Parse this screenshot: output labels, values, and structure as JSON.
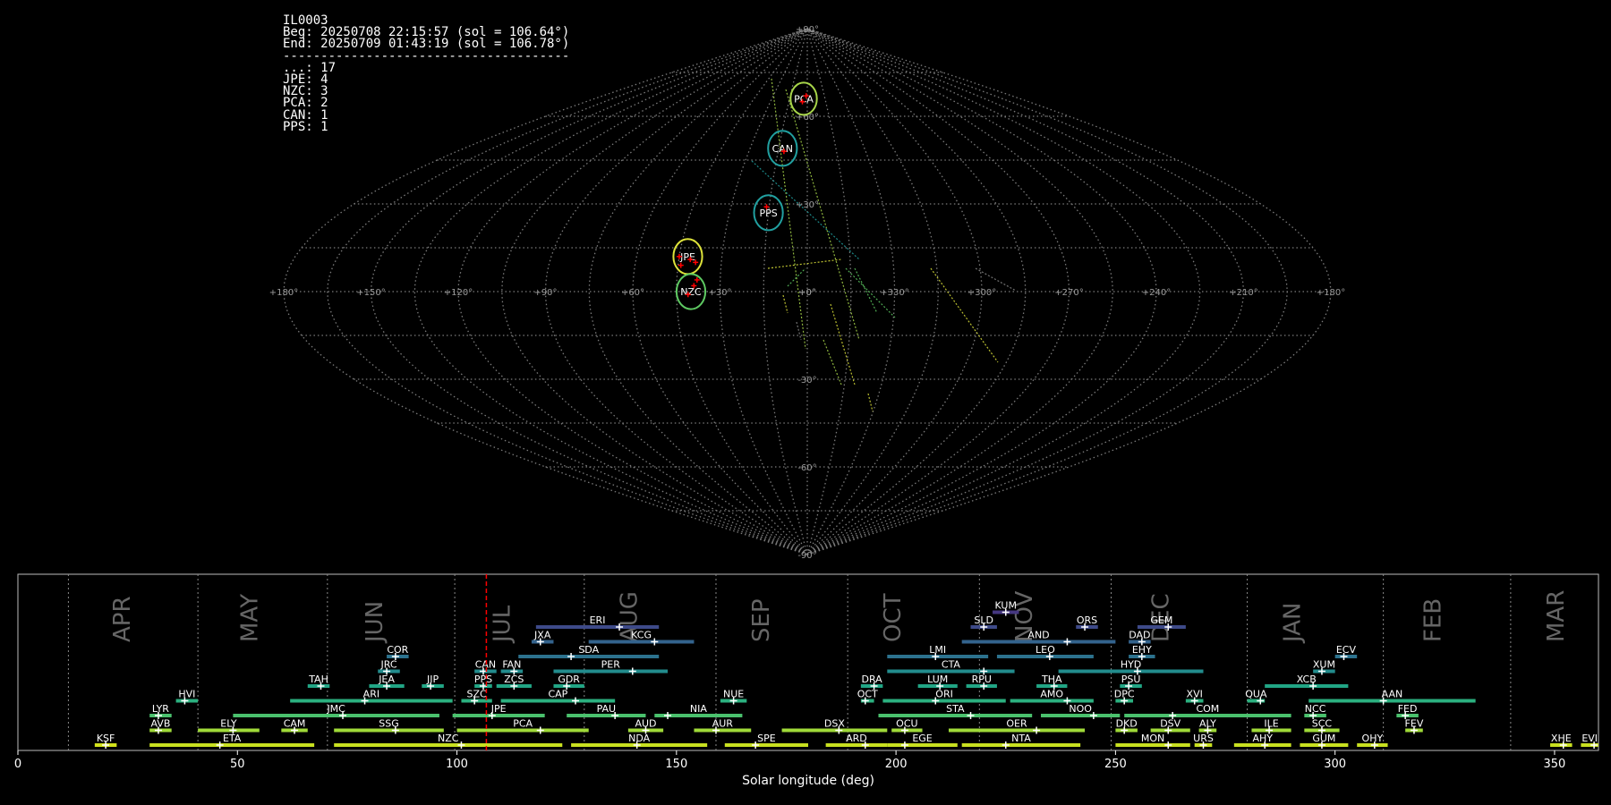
{
  "info": {
    "id": "IL0003",
    "beg": "Beg: 20250708 22:15:57 (sol = 106.64°)",
    "end": "End: 20250709 01:43:19 (sol = 106.78°)",
    "separator": "--------------------------------------",
    "counts": [
      "...: 17",
      "JPE: 4",
      "NZC: 3",
      "PCA: 2",
      "CAN: 1",
      "PPS: 1"
    ]
  },
  "colors": {
    "background": "#000000",
    "grid": "#9a9a9a",
    "highlight": "#ff0000",
    "yellow": "#dde23a",
    "green": "#5ec962",
    "teal": "#21a0a0",
    "blue": "#3b528b"
  },
  "chart_data": [
    {
      "type": "scatter",
      "projection": "sinusoidal",
      "lon_ticks": [
        "+180°",
        "+150°",
        "+120°",
        "+90°",
        "+60°",
        "+30°",
        "+0°",
        "+330°",
        "+300°",
        "+270°",
        "+240°",
        "+210°",
        "+180°"
      ],
      "lat_ticks": [
        "+90°",
        "+60°",
        "+30°",
        "+0°",
        "-30°",
        "-60°",
        "-90°"
      ],
      "grid": true,
      "shower_circles": [
        {
          "name": "PCA",
          "lon": -3,
          "lat": 66,
          "r": 5.5,
          "color": "#a8d64a"
        },
        {
          "name": "CAN",
          "lon": -13,
          "lat": 49,
          "r": 6,
          "color": "#21a0a0"
        },
        {
          "name": "PPS",
          "lon": -15,
          "lat": 27,
          "r": 6,
          "color": "#21a0a0"
        },
        {
          "name": "JPE",
          "lon": -42,
          "lat": 12,
          "r": 6,
          "color": "#dde23a"
        },
        {
          "name": "NZC",
          "lon": -40,
          "lat": 0,
          "r": 6,
          "color": "#5ec962"
        }
      ],
      "radiants": [
        {
          "lon": -1,
          "lat": 67
        },
        {
          "lon": -4,
          "lat": 65
        },
        {
          "lon": -12,
          "lat": 48
        },
        {
          "lon": -16,
          "lat": 29
        },
        {
          "lon": -41,
          "lat": 11
        },
        {
          "lon": -44,
          "lat": 9
        },
        {
          "lon": -39,
          "lat": 10
        },
        {
          "lon": -45,
          "lat": 12
        },
        {
          "lon": -38,
          "lat": 4
        },
        {
          "lon": -41,
          "lat": -1
        },
        {
          "lon": -39,
          "lat": 2
        }
      ]
    },
    {
      "type": "bar",
      "xlabel": "Solar longitude (deg)",
      "xlim": [
        0,
        360
      ],
      "x_ticks": [
        0,
        50,
        100,
        150,
        200,
        250,
        300,
        350
      ],
      "current_sol": 106.7,
      "months": [
        {
          "name": "APR",
          "x": 25.5,
          "line": 11.5
        },
        {
          "name": "MAY",
          "x": 54.5,
          "line": 41
        },
        {
          "name": "JUN",
          "x": 83,
          "line": 70.5
        },
        {
          "name": "JUL",
          "x": 112,
          "line": 99.5
        },
        {
          "name": "AUG",
          "x": 141,
          "line": 129
        },
        {
          "name": "SEP",
          "x": 171,
          "line": 159
        },
        {
          "name": "OCT",
          "x": 201,
          "line": 189
        },
        {
          "name": "NOV",
          "x": 231,
          "line": 219
        },
        {
          "name": "DEC",
          "x": 262,
          "line": 249
        },
        {
          "name": "JAN",
          "x": 292,
          "line": 280
        },
        {
          "name": "FEB",
          "x": 324,
          "line": 311
        },
        {
          "name": "MAR",
          "x": 352,
          "line": 340
        }
      ],
      "showers": [
        {
          "name": "KSF",
          "start": 17.5,
          "end": 22.5,
          "peak": 20,
          "row": 0,
          "color": "#d2e21b"
        },
        {
          "name": "ETA",
          "start": 30,
          "end": 67.5,
          "peak": 46,
          "row": 0,
          "color": "#c8e020"
        },
        {
          "name": "NZC",
          "start": 72,
          "end": 124,
          "peak": 101,
          "row": 0,
          "color": "#c8e020"
        },
        {
          "name": "NDA",
          "start": 126,
          "end": 157,
          "peak": 141,
          "row": 0,
          "color": "#c8e020"
        },
        {
          "name": "SPE",
          "start": 161,
          "end": 180,
          "peak": 168,
          "row": 0,
          "color": "#c8e020"
        },
        {
          "name": "ARD",
          "start": 184,
          "end": 198,
          "peak": 193,
          "row": 0,
          "color": "#c8e020"
        },
        {
          "name": "EGE",
          "start": 198,
          "end": 214,
          "peak": 202,
          "row": 0,
          "color": "#c8e020"
        },
        {
          "name": "NTA",
          "start": 215,
          "end": 242,
          "peak": 225,
          "row": 0,
          "color": "#c8e020"
        },
        {
          "name": "MON",
          "start": 250,
          "end": 267,
          "peak": 262,
          "row": 0,
          "color": "#c8e020"
        },
        {
          "name": "URS",
          "start": 268,
          "end": 272,
          "peak": 270,
          "row": 0,
          "color": "#c8e020"
        },
        {
          "name": "AHY",
          "start": 277,
          "end": 290,
          "peak": 284,
          "row": 0,
          "color": "#c8e020"
        },
        {
          "name": "GUM",
          "start": 292,
          "end": 303,
          "peak": 297,
          "row": 0,
          "color": "#c8e020"
        },
        {
          "name": "OHY",
          "start": 305,
          "end": 312,
          "peak": 309,
          "row": 0,
          "color": "#c8e020"
        },
        {
          "name": "XHE",
          "start": 349,
          "end": 354,
          "peak": 352,
          "row": 0,
          "color": "#c8e020"
        },
        {
          "name": "EVI",
          "start": 356,
          "end": 361,
          "peak": 359,
          "row": 0,
          "color": "#c8e020"
        },
        {
          "name": "AVB",
          "start": 30,
          "end": 35,
          "peak": 32,
          "row": 1,
          "color": "#a0da39"
        },
        {
          "name": "ELY",
          "start": 41,
          "end": 55,
          "peak": 49,
          "row": 1,
          "color": "#a0da39"
        },
        {
          "name": "CAM",
          "start": 60,
          "end": 66,
          "peak": 63,
          "row": 1,
          "color": "#a0da39"
        },
        {
          "name": "SSG",
          "start": 72,
          "end": 97,
          "peak": 86,
          "row": 1,
          "color": "#a0da39"
        },
        {
          "name": "PCA",
          "start": 100,
          "end": 130,
          "peak": 119,
          "row": 1,
          "color": "#a0da39"
        },
        {
          "name": "AUD",
          "start": 139,
          "end": 147,
          "peak": 143,
          "row": 1,
          "color": "#a0da39"
        },
        {
          "name": "AUR",
          "start": 154,
          "end": 167,
          "peak": 159,
          "row": 1,
          "color": "#a0da39"
        },
        {
          "name": "DSX",
          "start": 174,
          "end": 198,
          "peak": 187,
          "row": 1,
          "color": "#a0da39"
        },
        {
          "name": "OCU",
          "start": 199,
          "end": 206,
          "peak": 202,
          "row": 1,
          "color": "#a0da39"
        },
        {
          "name": "OER",
          "start": 212,
          "end": 243,
          "peak": 232,
          "row": 1,
          "color": "#a0da39"
        },
        {
          "name": "DKD",
          "start": 250,
          "end": 255,
          "peak": 252,
          "row": 1,
          "color": "#a0da39"
        },
        {
          "name": "DSV",
          "start": 258,
          "end": 267,
          "peak": 262,
          "row": 1,
          "color": "#a0da39"
        },
        {
          "name": "ALY",
          "start": 269,
          "end": 273,
          "peak": 271,
          "row": 1,
          "color": "#a0da39"
        },
        {
          "name": "ILE",
          "start": 281,
          "end": 290,
          "peak": 285,
          "row": 1,
          "color": "#a0da39"
        },
        {
          "name": "SCC",
          "start": 293,
          "end": 301,
          "peak": 297,
          "row": 1,
          "color": "#a0da39"
        },
        {
          "name": "FEV",
          "start": 316,
          "end": 320,
          "peak": 318,
          "row": 1,
          "color": "#a0da39"
        },
        {
          "name": "LYR",
          "start": 30,
          "end": 35,
          "peak": 32,
          "row": 2,
          "color": "#4ac16d"
        },
        {
          "name": "JMC",
          "start": 49,
          "end": 96,
          "peak": 74,
          "row": 2,
          "color": "#4ac16d"
        },
        {
          "name": "JPE",
          "start": 99,
          "end": 120,
          "peak": 108,
          "row": 2,
          "color": "#4ac16d"
        },
        {
          "name": "PAU",
          "start": 125,
          "end": 143,
          "peak": 136,
          "row": 2,
          "color": "#4ac16d"
        },
        {
          "name": "NIA",
          "start": 145,
          "end": 165,
          "peak": 148,
          "row": 2,
          "color": "#4ac16d"
        },
        {
          "name": "STA",
          "start": 196,
          "end": 231,
          "peak": 217,
          "row": 2,
          "color": "#4ac16d"
        },
        {
          "name": "NOO",
          "start": 233,
          "end": 251,
          "peak": 245,
          "row": 2,
          "color": "#4ac16d"
        },
        {
          "name": "COM",
          "start": 252,
          "end": 290,
          "peak": 263,
          "row": 2,
          "color": "#4ac16d"
        },
        {
          "name": "NCC",
          "start": 293,
          "end": 298,
          "peak": 295,
          "row": 2,
          "color": "#4ac16d"
        },
        {
          "name": "FED",
          "start": 314,
          "end": 319,
          "peak": 316,
          "row": 2,
          "color": "#4ac16d"
        },
        {
          "name": "HVI",
          "start": 36,
          "end": 41,
          "peak": 38,
          "row": 3,
          "color": "#2bb07f"
        },
        {
          "name": "ARI",
          "start": 62,
          "end": 99,
          "peak": 79,
          "row": 3,
          "color": "#2bb07f"
        },
        {
          "name": "SZC",
          "start": 101,
          "end": 108,
          "peak": 104,
          "row": 3,
          "color": "#2bb07f"
        },
        {
          "name": "CAP",
          "start": 110,
          "end": 136,
          "peak": 127,
          "row": 3,
          "color": "#2bb07f"
        },
        {
          "name": "NUE",
          "start": 160,
          "end": 166,
          "peak": 163,
          "row": 3,
          "color": "#2bb07f"
        },
        {
          "name": "OCT",
          "start": 192,
          "end": 195,
          "peak": 193,
          "row": 3,
          "color": "#2bb07f"
        },
        {
          "name": "ORI",
          "start": 197,
          "end": 225,
          "peak": 209,
          "row": 3,
          "color": "#2bb07f"
        },
        {
          "name": "AMO",
          "start": 226,
          "end": 245,
          "peak": 239,
          "row": 3,
          "color": "#2bb07f"
        },
        {
          "name": "DPC",
          "start": 250,
          "end": 254,
          "peak": 252,
          "row": 3,
          "color": "#2bb07f"
        },
        {
          "name": "XVI",
          "start": 266,
          "end": 270,
          "peak": 268,
          "row": 3,
          "color": "#2bb07f"
        },
        {
          "name": "QUA",
          "start": 280,
          "end": 284,
          "peak": 283,
          "row": 3,
          "color": "#2bb07f"
        },
        {
          "name": "AAN",
          "start": 294,
          "end": 332,
          "peak": 311,
          "row": 3,
          "color": "#2bb07f"
        },
        {
          "name": "TAH",
          "start": 66,
          "end": 71,
          "peak": 69,
          "row": 4,
          "color": "#21a585"
        },
        {
          "name": "JEA",
          "start": 80,
          "end": 88,
          "peak": 84,
          "row": 4,
          "color": "#21a585"
        },
        {
          "name": "JIP",
          "start": 92,
          "end": 97,
          "peak": 94,
          "row": 4,
          "color": "#21a585"
        },
        {
          "name": "PPS",
          "start": 104,
          "end": 108,
          "peak": 106,
          "row": 4,
          "color": "#21a585"
        },
        {
          "name": "ZCS",
          "start": 109,
          "end": 117,
          "peak": 113,
          "row": 4,
          "color": "#21a585"
        },
        {
          "name": "GDR",
          "start": 122,
          "end": 129,
          "peak": 125,
          "row": 4,
          "color": "#21a585"
        },
        {
          "name": "DRA",
          "start": 192,
          "end": 197,
          "peak": 195,
          "row": 4,
          "color": "#21a585"
        },
        {
          "name": "LUM",
          "start": 205,
          "end": 214,
          "peak": 210,
          "row": 4,
          "color": "#21a585"
        },
        {
          "name": "RPU",
          "start": 216,
          "end": 223,
          "peak": 220,
          "row": 4,
          "color": "#21a585"
        },
        {
          "name": "THA",
          "start": 232,
          "end": 239,
          "peak": 236,
          "row": 4,
          "color": "#21a585"
        },
        {
          "name": "PSU",
          "start": 251,
          "end": 256,
          "peak": 253,
          "row": 4,
          "color": "#21a585"
        },
        {
          "name": "XCB",
          "start": 284,
          "end": 303,
          "peak": 295,
          "row": 4,
          "color": "#21a585"
        },
        {
          "name": "JRC",
          "start": 82,
          "end": 87,
          "peak": 84,
          "row": 5,
          "color": "#228c8d"
        },
        {
          "name": "CAN",
          "start": 104,
          "end": 109,
          "peak": 106,
          "row": 5,
          "color": "#228c8d"
        },
        {
          "name": "FAN",
          "start": 110,
          "end": 115,
          "peak": 113,
          "row": 5,
          "color": "#228c8d"
        },
        {
          "name": "PER",
          "start": 122,
          "end": 148,
          "peak": 140,
          "row": 5,
          "color": "#228c8d"
        },
        {
          "name": "CTA",
          "start": 198,
          "end": 227,
          "peak": 220,
          "row": 5,
          "color": "#228c8d"
        },
        {
          "name": "HYD",
          "start": 237,
          "end": 270,
          "peak": 255,
          "row": 5,
          "color": "#228c8d"
        },
        {
          "name": "XUM",
          "start": 295,
          "end": 300,
          "peak": 297,
          "row": 5,
          "color": "#228c8d"
        },
        {
          "name": "COR",
          "start": 84,
          "end": 89,
          "peak": 86,
          "row": 6,
          "color": "#2c728e"
        },
        {
          "name": "SDA",
          "start": 114,
          "end": 146,
          "peak": 126,
          "row": 6,
          "color": "#2c728e"
        },
        {
          "name": "LMI",
          "start": 198,
          "end": 221,
          "peak": 209,
          "row": 6,
          "color": "#2c728e"
        },
        {
          "name": "LEO",
          "start": 223,
          "end": 245,
          "peak": 235,
          "row": 6,
          "color": "#2c728e"
        },
        {
          "name": "EHY",
          "start": 253,
          "end": 259,
          "peak": 256,
          "row": 6,
          "color": "#2c728e"
        },
        {
          "name": "ECV",
          "start": 300,
          "end": 305,
          "peak": 302,
          "row": 6,
          "color": "#2c728e"
        },
        {
          "name": "JXA",
          "start": 117,
          "end": 122,
          "peak": 119,
          "row": 7,
          "color": "#33638d"
        },
        {
          "name": "KCG",
          "start": 130,
          "end": 154,
          "peak": 145,
          "row": 7,
          "color": "#33638d"
        },
        {
          "name": "AND",
          "start": 215,
          "end": 250,
          "peak": 239,
          "row": 7,
          "color": "#33638d"
        },
        {
          "name": "DAD",
          "start": 253,
          "end": 258,
          "peak": 256,
          "row": 7,
          "color": "#33638d"
        },
        {
          "name": "ERI",
          "start": 118,
          "end": 146,
          "peak": 137,
          "row": 8,
          "color": "#3e4a89"
        },
        {
          "name": "SLD",
          "start": 217,
          "end": 223,
          "peak": 220,
          "row": 8,
          "color": "#3e4a89"
        },
        {
          "name": "ORS",
          "start": 241,
          "end": 246,
          "peak": 243,
          "row": 8,
          "color": "#3e4a89"
        },
        {
          "name": "GEM",
          "start": 255,
          "end": 266,
          "peak": 262,
          "row": 8,
          "color": "#3e4a89"
        },
        {
          "name": "KUM",
          "start": 222,
          "end": 228,
          "peak": 225,
          "row": 9,
          "color": "#453781"
        }
      ]
    }
  ]
}
